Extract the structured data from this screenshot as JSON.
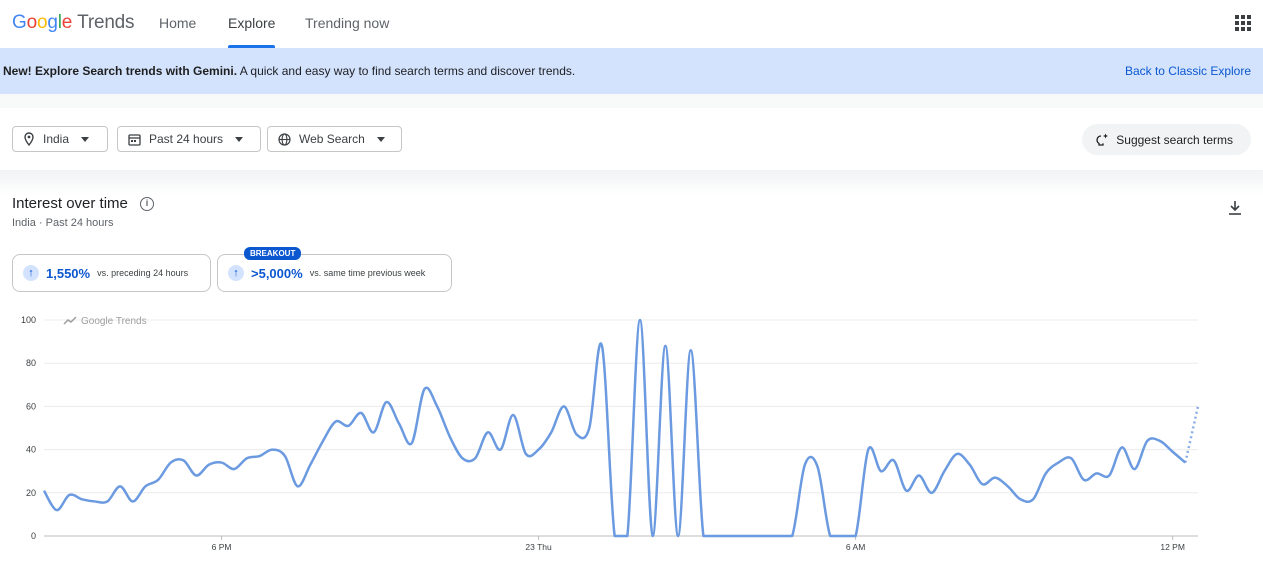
{
  "header": {
    "logo_letters": [
      {
        "ch": "G",
        "color": "#4285F4"
      },
      {
        "ch": "o",
        "color": "#EA4335"
      },
      {
        "ch": "o",
        "color": "#FBBC05"
      },
      {
        "ch": "g",
        "color": "#4285F4"
      },
      {
        "ch": "l",
        "color": "#34A853"
      },
      {
        "ch": "e",
        "color": "#EA4335"
      }
    ],
    "logo_suffix": "Trends",
    "nav": [
      {
        "label": "Home"
      },
      {
        "label": "Explore"
      },
      {
        "label": "Trending now"
      }
    ],
    "active_nav": "Explore",
    "apps_icon": "apps-grid-icon"
  },
  "banner": {
    "bold": "New! Explore Search trends with Gemini.",
    "text": "A quick and easy way to find search terms and discover trends.",
    "link": "Back to Classic Explore"
  },
  "filters": {
    "location": "India",
    "time": "Past 24 hours",
    "property": "Web Search",
    "suggest": "Suggest search terms"
  },
  "card": {
    "title": "Interest over time",
    "subtitle": "India · Past 24 hours",
    "stats": [
      {
        "value": "1,550%",
        "label": "vs. preceding 24 hours"
      },
      {
        "value": ">5,000%",
        "label": "vs. same time previous week",
        "badge": "BREAKOUT"
      }
    ]
  },
  "chart_data": {
    "type": "line",
    "watermark": "Google Trends",
    "ylim": [
      0,
      100
    ],
    "yticks": [
      "0",
      "20",
      "40",
      "60",
      "80",
      "100"
    ],
    "xticks": [
      {
        "label": "6 PM",
        "index": 14
      },
      {
        "label": "23 Thu",
        "index": 39
      },
      {
        "label": "6 AM",
        "index": 64
      },
      {
        "label": "12 PM",
        "index": 89
      }
    ],
    "line_color": "#6b9ae0",
    "values": [
      21,
      12,
      19,
      17,
      16,
      16,
      23,
      16,
      23,
      26,
      34,
      35,
      28,
      33,
      34,
      31,
      36,
      37,
      40,
      37,
      23,
      33,
      44,
      53,
      51,
      57,
      48,
      62,
      52,
      43,
      68,
      60,
      46,
      36,
      36,
      48,
      40,
      56,
      38,
      40,
      48,
      60,
      47,
      50,
      88,
      0,
      0,
      100,
      0,
      88,
      0,
      86,
      0,
      0,
      0,
      0,
      0,
      0,
      0,
      0,
      33,
      32,
      0,
      0,
      0,
      40,
      30,
      35,
      21,
      28,
      20,
      30,
      38,
      33,
      24,
      27,
      23,
      17,
      17,
      29,
      34,
      36,
      26,
      29,
      28,
      41,
      31,
      44,
      44,
      39,
      34
    ],
    "partial_values": [
      34,
      60
    ]
  }
}
